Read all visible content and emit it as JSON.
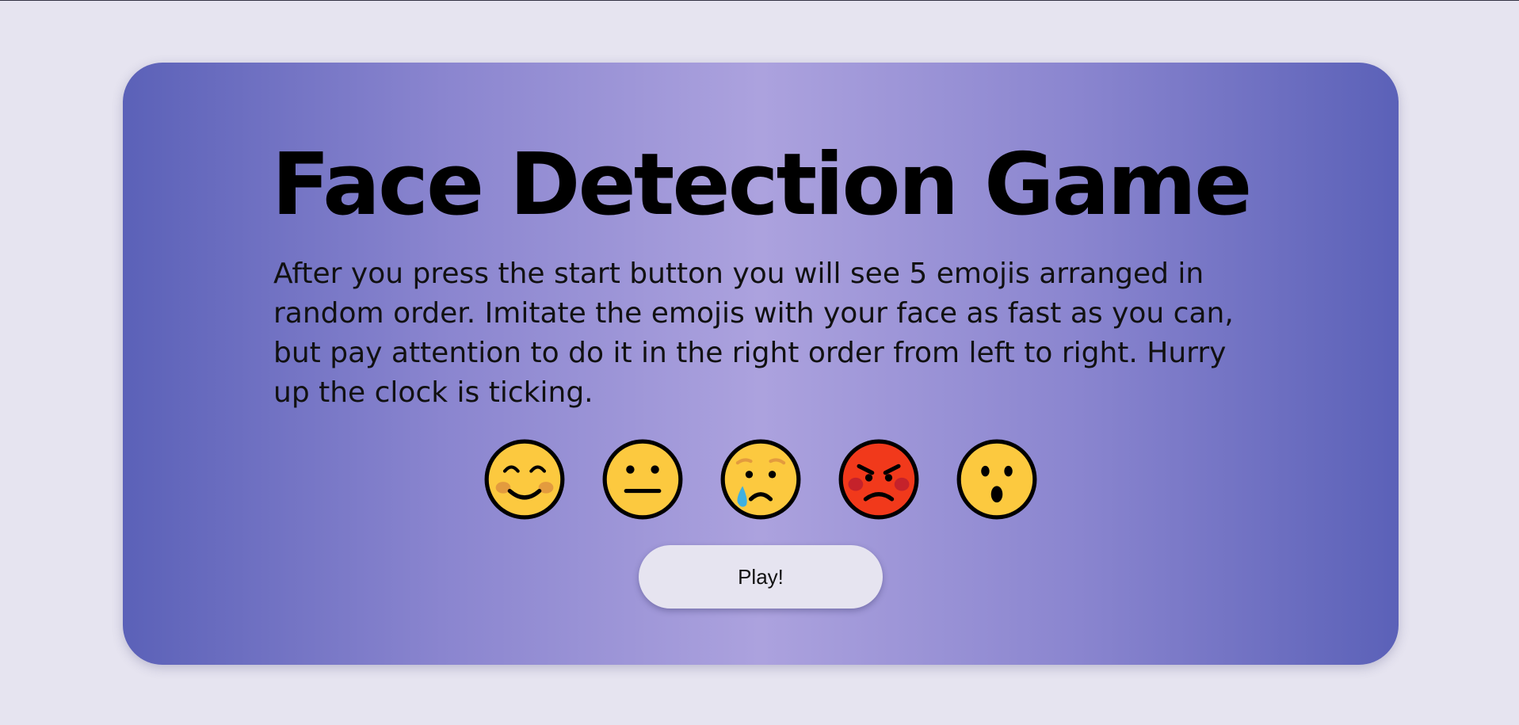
{
  "title": "Face Detection Game",
  "description": "After you press the start button you will see 5 emojis arranged in random order. Imitate the emojis with your face as fast as you can, but pay attention to do it in the right order from left to right. Hurry up the clock is ticking.",
  "emojis": [
    {
      "icon": "smiling-face-icon",
      "color": "#fcc93f"
    },
    {
      "icon": "neutral-face-icon",
      "color": "#fcc93f"
    },
    {
      "icon": "crying-face-icon",
      "color": "#fcc93f"
    },
    {
      "icon": "angry-face-icon",
      "color": "#f1391b"
    },
    {
      "icon": "surprised-face-icon",
      "color": "#fcc93f"
    }
  ],
  "play_button": {
    "label": "Play!"
  },
  "colors": {
    "page_background": "#e6e4f0",
    "card_gradient_edge": "#5b61b8",
    "card_gradient_center": "#aca2de",
    "button_background": "#e6e4f0"
  }
}
